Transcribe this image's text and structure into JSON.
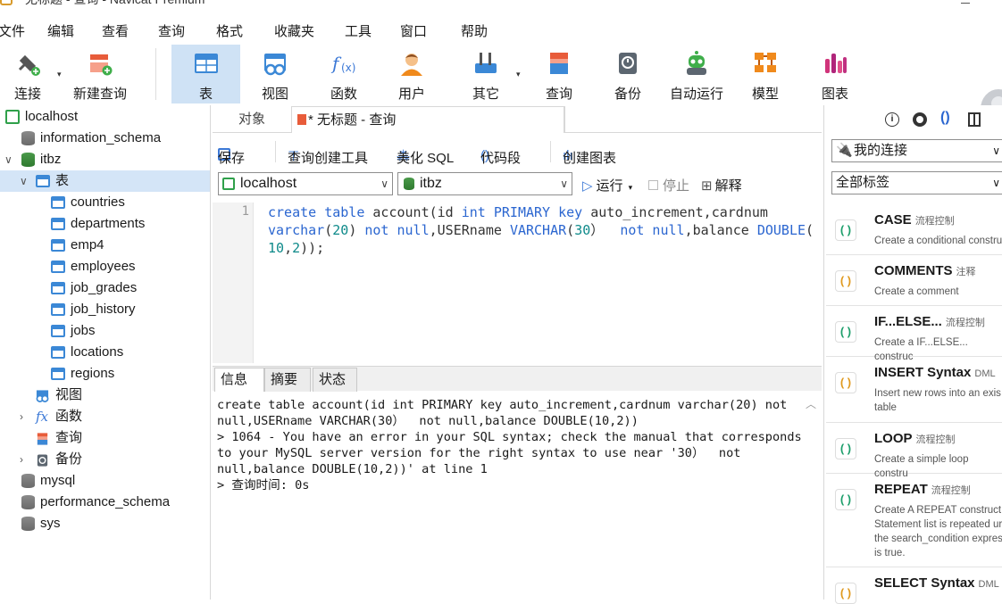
{
  "window": {
    "title": "无标题 - 查询 - Navicat Premium"
  },
  "menu": [
    "文件",
    "编辑",
    "查看",
    "查询",
    "格式",
    "收藏夹",
    "工具",
    "窗口",
    "帮助"
  ],
  "toolbar": {
    "buttons": [
      {
        "label": "连接",
        "icon": "plug-icon"
      },
      {
        "label": "新建查询",
        "icon": "new-query-icon"
      },
      {
        "label": "表",
        "icon": "table-icon"
      },
      {
        "label": "视图",
        "icon": "view-icon"
      },
      {
        "label": "函数",
        "icon": "function-icon"
      },
      {
        "label": "用户",
        "icon": "user-icon"
      },
      {
        "label": "其它",
        "icon": "tools-icon"
      },
      {
        "label": "查询",
        "icon": "query-icon"
      },
      {
        "label": "备份",
        "icon": "backup-icon"
      },
      {
        "label": "自动运行",
        "icon": "robot-icon"
      },
      {
        "label": "模型",
        "icon": "model-icon"
      },
      {
        "label": "图表",
        "icon": "chart-icon"
      }
    ]
  },
  "sidebar": {
    "tree": [
      {
        "label": "localhost",
        "type": "conn",
        "level": 0
      },
      {
        "label": "information_schema",
        "type": "db",
        "level": 1
      },
      {
        "label": "itbz",
        "type": "db",
        "level": 1,
        "expanded": true
      },
      {
        "label": "表",
        "type": "folder-table",
        "level": 2,
        "expanded": true,
        "selected": true
      },
      {
        "label": "countries",
        "type": "table",
        "level": 3
      },
      {
        "label": "departments",
        "type": "table",
        "level": 3
      },
      {
        "label": "emp4",
        "type": "table",
        "level": 3
      },
      {
        "label": "employees",
        "type": "table",
        "level": 3
      },
      {
        "label": "job_grades",
        "type": "table",
        "level": 3
      },
      {
        "label": "job_history",
        "type": "table",
        "level": 3
      },
      {
        "label": "jobs",
        "type": "table",
        "level": 3
      },
      {
        "label": "locations",
        "type": "table",
        "level": 3
      },
      {
        "label": "regions",
        "type": "table",
        "level": 3
      },
      {
        "label": "视图",
        "type": "folder-view",
        "level": 2
      },
      {
        "label": "函数",
        "type": "folder-func",
        "level": 2,
        "collapsed": true
      },
      {
        "label": "查询",
        "type": "folder-query",
        "level": 2
      },
      {
        "label": "备份",
        "type": "folder-backup",
        "level": 2,
        "collapsed": true
      },
      {
        "label": "mysql",
        "type": "db",
        "level": 1
      },
      {
        "label": "performance_schema",
        "type": "db",
        "level": 1
      },
      {
        "label": "sys",
        "type": "db",
        "level": 1
      }
    ]
  },
  "tabs": {
    "objects": "对象",
    "query": "* 无标题 - 查询"
  },
  "query_toolbar": {
    "save": "保存",
    "builder": "查询创建工具",
    "beautify": "美化 SQL",
    "snippet": "代码段",
    "create_chart": "创建图表"
  },
  "connection_bar": {
    "connection": "localhost",
    "database": "itbz",
    "run": "运行",
    "stop": "停止",
    "explain": "解释"
  },
  "editor": {
    "line": "1"
  },
  "result_tabs": [
    "信息",
    "摘要",
    "状态"
  ],
  "result": {
    "lines": [
      "create table account(id int PRIMARY key auto_increment,cardnum varchar(20) not",
      "null,USERname VARCHAR(30）  not null,balance DOUBLE(10,2))",
      "> 1064 - You have an error in your SQL syntax; check the manual that corresponds",
      "to your MySQL server version for the right syntax to use near '30）  not",
      "null,balance DOUBLE(10,2))' at line 1",
      "> 查询时间: 0s"
    ]
  },
  "right_panel": {
    "connection_select": "我的连接",
    "tag_select": "全部标签",
    "snippets": [
      {
        "title": "CASE",
        "tag": "流程控制",
        "desc": "Create a conditional constru"
      },
      {
        "title": "COMMENTS",
        "tag": "注释",
        "desc": "Create a comment"
      },
      {
        "title": "IF...ELSE...",
        "tag": "流程控制",
        "desc": "Create a IF...ELSE... construc"
      },
      {
        "title": "INSERT Syntax",
        "tag": "DML",
        "desc": "Insert new rows into an exis table"
      },
      {
        "title": "LOOP",
        "tag": "流程控制",
        "desc": "Create a simple loop constru"
      },
      {
        "title": "REPEAT",
        "tag": "流程控制",
        "desc": "Create A REPEAT construct Statement list is repeated ur the search_condition expres is true."
      },
      {
        "title": "SELECT Syntax",
        "tag": "DML",
        "desc": ""
      }
    ]
  }
}
